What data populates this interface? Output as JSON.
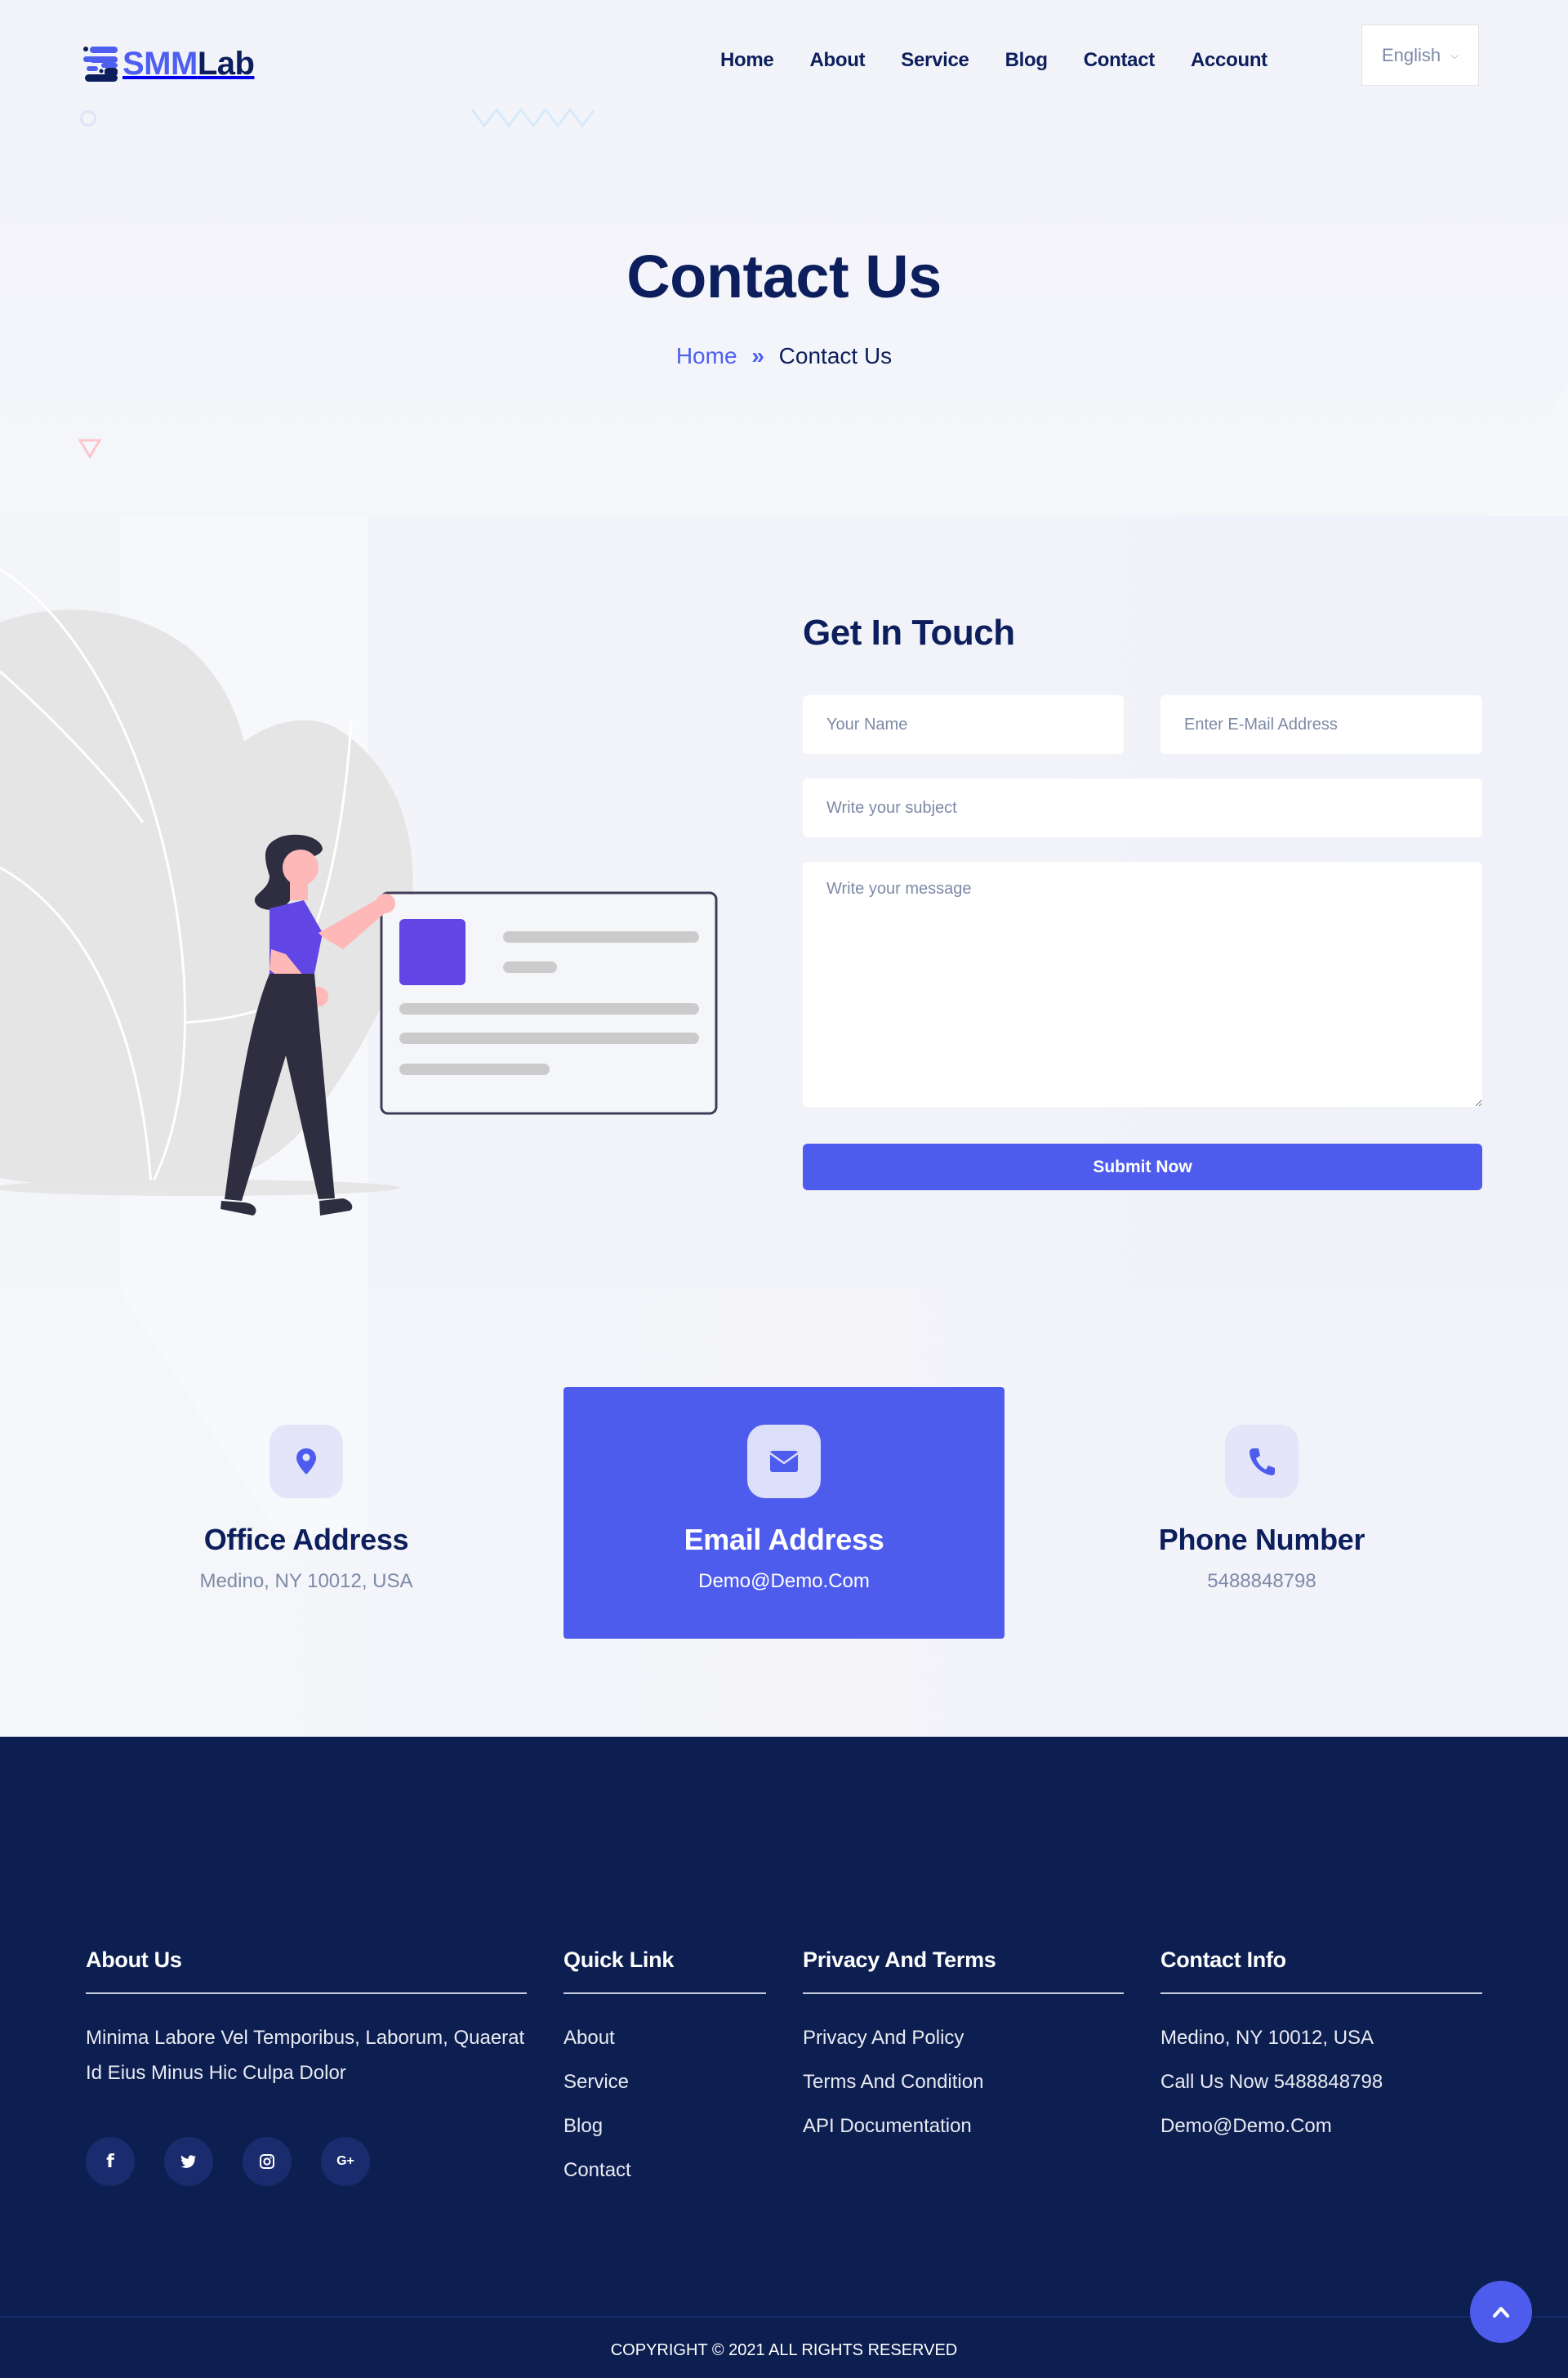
{
  "brand": {
    "name_part1": "SMM",
    "name_part2": "Lab",
    "accent": "#4e5ced",
    "navy": "#0c1e5b"
  },
  "nav": {
    "items": [
      {
        "label": "Home"
      },
      {
        "label": "About"
      },
      {
        "label": "Service"
      },
      {
        "label": "Blog"
      },
      {
        "label": "Contact"
      },
      {
        "label": "Account"
      }
    ],
    "language": {
      "selected": "English",
      "icon": "chevron-down-icon"
    }
  },
  "hero": {
    "title": "Contact Us",
    "breadcrumb": {
      "home": "Home",
      "separator_icon": "double-chevron-right-icon",
      "current": "Contact Us"
    }
  },
  "form": {
    "title": "Get In Touch",
    "name": {
      "value": "",
      "placeholder": "Your Name"
    },
    "email": {
      "value": "",
      "placeholder": "Enter E-Mail Address"
    },
    "subject": {
      "value": "",
      "placeholder": "Write your subject"
    },
    "message": {
      "value": "",
      "placeholder": "Write your message"
    },
    "submit_label": "Submit Now"
  },
  "info_cards": [
    {
      "icon": "map-pin-icon",
      "title": "Office Address",
      "value": "Medino, NY 10012, USA",
      "active": false
    },
    {
      "icon": "envelope-icon",
      "title": "Email Address",
      "value": "Demo@Demo.Com",
      "active": true
    },
    {
      "icon": "phone-icon",
      "title": "Phone Number",
      "value": "5488848798",
      "active": false
    }
  ],
  "footer": {
    "about": {
      "title": "About Us",
      "text": "Minima Labore Vel Temporibus, Laborum, Quaerat Id Eius Minus Hic Culpa Dolor"
    },
    "socials": [
      {
        "icon": "facebook-icon",
        "glyph": "f"
      },
      {
        "icon": "twitter-icon",
        "glyph": ""
      },
      {
        "icon": "instagram-icon",
        "glyph": ""
      },
      {
        "icon": "google-plus-icon",
        "glyph": "G+"
      }
    ],
    "quick_link": {
      "title": "Quick Link",
      "items": [
        "About",
        "Service",
        "Blog",
        "Contact"
      ]
    },
    "privacy": {
      "title": "Privacy And Terms",
      "items": [
        "Privacy And Policy",
        "Terms And Condition",
        "API Documentation"
      ]
    },
    "contact": {
      "title": "Contact Info",
      "items": [
        "Medino, NY 10012, USA",
        "Call Us Now 5488848798",
        "Demo@Demo.Com"
      ]
    },
    "copyright": "COPYRIGHT © 2021 ALL RIGHTS RESERVED",
    "back_to_top_icon": "chevron-up-icon"
  }
}
